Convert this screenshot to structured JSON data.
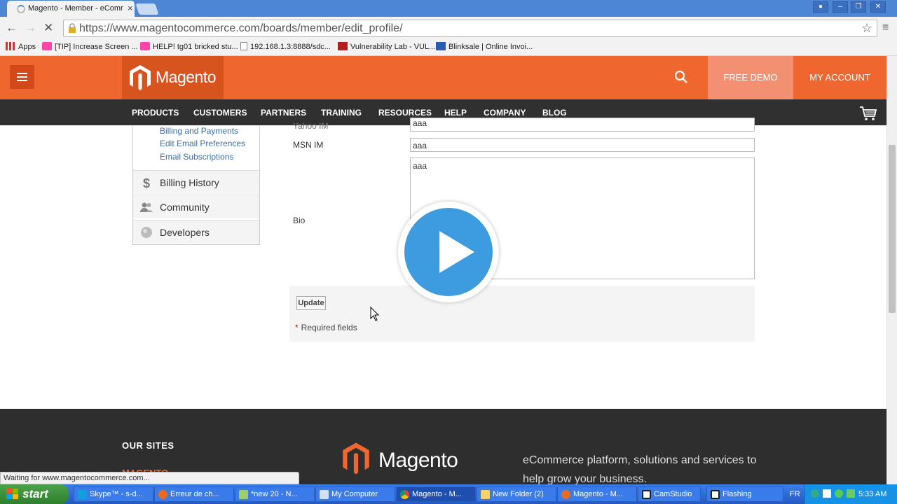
{
  "browser": {
    "tab_title": "Magento - Member - eComm",
    "tab_close": "×",
    "url": "https://www.magentocommerce.com/boards/member/edit_profile/",
    "bookmarks": [
      "Apps",
      "[TIP] Increase Screen ...",
      "HELP! tg01 bricked stu...",
      "192.168.1.3:8888/sdc...",
      "Vulnerability Lab - VUL...",
      "Blinksale | Online Invoi..."
    ],
    "status": "Waiting for www.magentocommerce.com..."
  },
  "header": {
    "logo": "Magento",
    "free_demo": "FREE DEMO",
    "my_account": "MY ACCOUNT"
  },
  "nav": [
    "PRODUCTS",
    "CUSTOMERS",
    "PARTNERS",
    "TRAINING",
    "RESOURCES",
    "HELP",
    "COMPANY",
    "BLOG"
  ],
  "sidebar": {
    "sublinks": [
      "Billing and Payments",
      "Edit Email Preferences",
      "Email Subscriptions"
    ],
    "sections": [
      "Billing History",
      "Community",
      "Developers"
    ]
  },
  "form": {
    "cut_label": "Yahoo IM",
    "cut_value": "aaa",
    "msn_label": "MSN IM",
    "msn_value": "aaa",
    "bio_label": "Bio",
    "bio_value": "aaa",
    "update": "Update",
    "required": "Required fields",
    "required_star": "*"
  },
  "footer": {
    "our_sites": "OUR SITES",
    "magento_link": "MAGENTO",
    "logo": "Magento",
    "tagline": "eCommerce platform, solutions and services to help grow your business."
  },
  "taskbar": {
    "start": "start",
    "tasks": [
      "Skype™ - s-d...",
      "Erreur de ch...",
      "*new 20 - N...",
      "My Computer",
      "Magento - M...",
      "New Folder (2)",
      "Magento - M...",
      "CamStudio",
      "Flashing"
    ],
    "lang": "FR",
    "clock": "5:33 AM"
  },
  "colors": {
    "brand": "#ef672f",
    "nav_bg": "#303030",
    "link": "#3a6ea5",
    "play": "#3d9be0"
  }
}
